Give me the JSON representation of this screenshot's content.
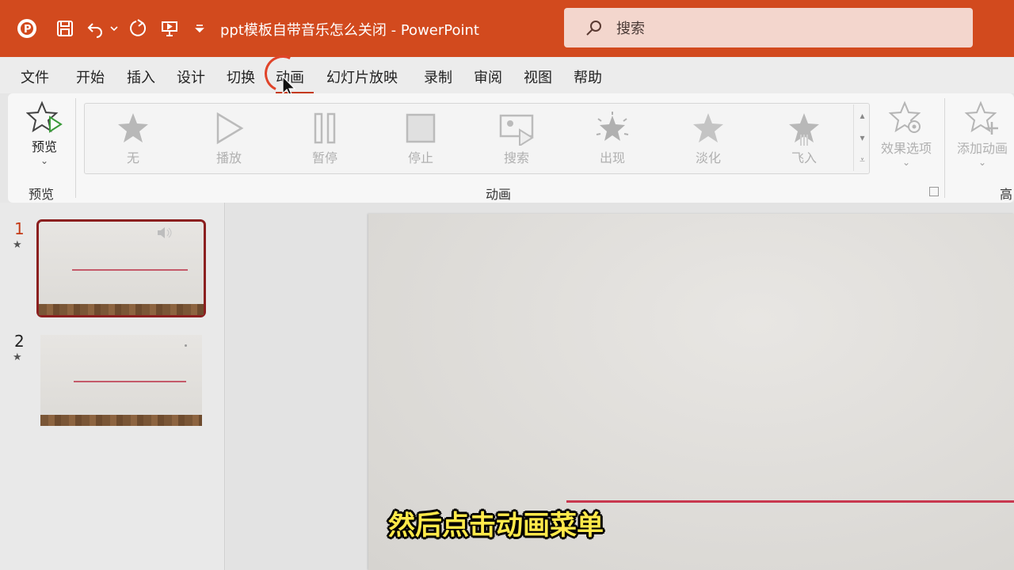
{
  "titlebar": {
    "title": "ppt模板自带音乐怎么关闭  -  PowerPoint",
    "search_placeholder": "搜索",
    "icons": [
      "powerpoint-logo-icon",
      "save-icon",
      "undo-icon",
      "undo-dropdown-icon",
      "redo-icon",
      "present-icon",
      "customize-qat-icon"
    ]
  },
  "menu": {
    "tabs": [
      "文件",
      "开始",
      "插入",
      "设计",
      "切换",
      "动画",
      "幻灯片放映",
      "录制",
      "审阅",
      "视图",
      "帮助"
    ],
    "active_tab": "动画"
  },
  "ribbon": {
    "preview": {
      "button": "预览",
      "group": "预览"
    },
    "animation_group": "动画",
    "gallery": [
      "无",
      "播放",
      "暂停",
      "停止",
      "搜索",
      "出现",
      "淡化",
      "飞入"
    ],
    "effect_options": "效果选项",
    "add_animation": "添加动画",
    "next_group_partial": "高"
  },
  "slides": [
    {
      "number": "1",
      "star": "★",
      "selected": true
    },
    {
      "number": "2",
      "star": "★",
      "selected": false
    }
  ],
  "subtitle": "然后点击动画菜单",
  "colors": {
    "accent": "#d24a1e",
    "selection": "#8b1f1f",
    "subtitle": "#ffe94a"
  }
}
